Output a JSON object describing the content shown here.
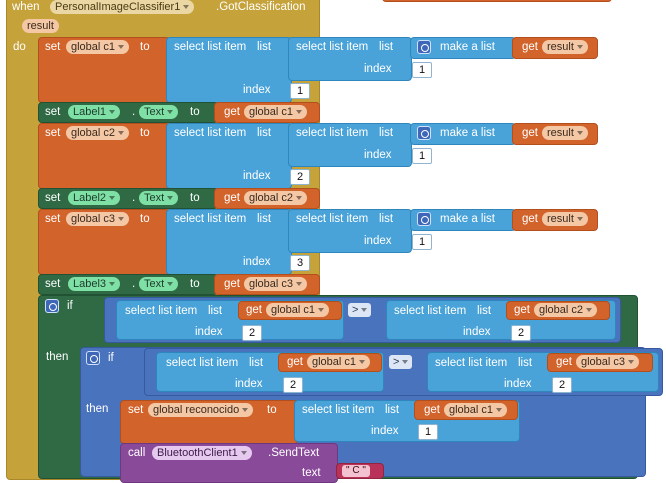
{
  "event": {
    "when": "when",
    "component": "PersonalImageClassifier1",
    "event_name": ".GotClassification",
    "param": "result",
    "do": "do"
  },
  "words": {
    "set": "set",
    "to": "to",
    "get": "get",
    "index": "index",
    "select_list_item": "select list item",
    "list": "list",
    "make_a_list": "make a list",
    "if": "if",
    "then": "then",
    "call": "call",
    "text": "text"
  },
  "vars": {
    "c1": "global c1",
    "c2": "global c2",
    "c3": "global c3",
    "result": "result",
    "reconocido": "global reconocido"
  },
  "labels": {
    "l1": "Label1",
    "l2": "Label2",
    "l3": "Label3"
  },
  "prop": {
    "text": "Text"
  },
  "nums": {
    "one": "1",
    "two": "2",
    "three": "3"
  },
  "ops": {
    "gt": ">"
  },
  "call": {
    "component": "BluetoothClient1",
    "method": ".SendText"
  },
  "string_value": "\" C \""
}
